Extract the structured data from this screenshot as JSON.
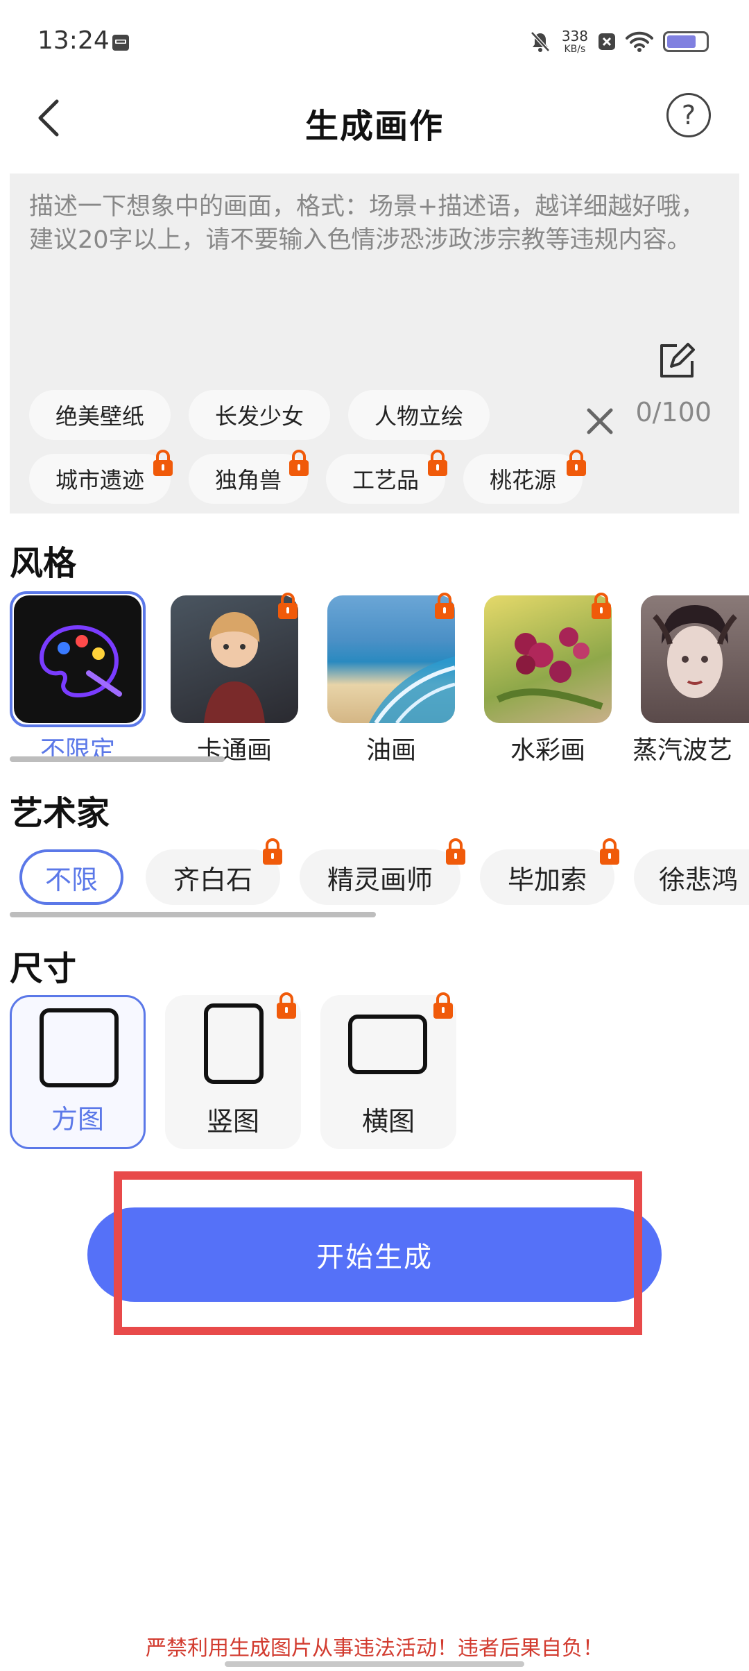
{
  "status_bar": {
    "time": "13:24",
    "net_speed_value": "338",
    "net_speed_unit": "KB/s",
    "battery_level": 0.75,
    "icons": [
      "calendar-icon",
      "mute-icon",
      "app-notification-icon",
      "wifi-icon",
      "battery-icon"
    ]
  },
  "header": {
    "title": "生成画作",
    "help_label": "?"
  },
  "prompt": {
    "placeholder": "描述一下想象中的画面，格式：场景+描述语，越详细越好哦，建议20字以上，请不要输入色情涉恐涉政涉宗教等违规内容。",
    "char_count": "0/100",
    "tags": [
      {
        "label": "绝美壁纸",
        "locked": false
      },
      {
        "label": "长发少女",
        "locked": false
      },
      {
        "label": "人物立绘",
        "locked": false
      },
      {
        "label": "城市遗迹",
        "locked": true
      },
      {
        "label": "独角兽",
        "locked": true
      },
      {
        "label": "工艺品",
        "locked": true
      },
      {
        "label": "桃花源",
        "locked": true
      }
    ]
  },
  "style_section": {
    "title": "风格",
    "items": [
      {
        "label": "不限定",
        "selected": true,
        "locked": false
      },
      {
        "label": "卡通画",
        "selected": false,
        "locked": true
      },
      {
        "label": "油画",
        "selected": false,
        "locked": true
      },
      {
        "label": "水彩画",
        "selected": false,
        "locked": true
      },
      {
        "label": "蒸汽波艺",
        "selected": false,
        "locked": false
      }
    ]
  },
  "artist_section": {
    "title": "艺术家",
    "items": [
      {
        "label": "不限",
        "selected": true,
        "locked": false
      },
      {
        "label": "齐白石",
        "selected": false,
        "locked": true
      },
      {
        "label": "精灵画师",
        "selected": false,
        "locked": true
      },
      {
        "label": "毕加索",
        "selected": false,
        "locked": true
      },
      {
        "label": "徐悲鸿",
        "selected": false,
        "locked": false
      }
    ]
  },
  "size_section": {
    "title": "尺寸",
    "items": [
      {
        "label": "方图",
        "selected": true,
        "locked": false
      },
      {
        "label": "竖图",
        "selected": false,
        "locked": true
      },
      {
        "label": "横图",
        "selected": false,
        "locked": true
      }
    ]
  },
  "start_button": {
    "label": "开始生成"
  },
  "footer": {
    "warning": "严禁利用生成图片从事违法活动！违者后果自负！"
  },
  "colors": {
    "accent": "#5571f8",
    "selected_border": "#5b78e8",
    "warning": "#d23b2f",
    "lock": "#f05a0a"
  }
}
